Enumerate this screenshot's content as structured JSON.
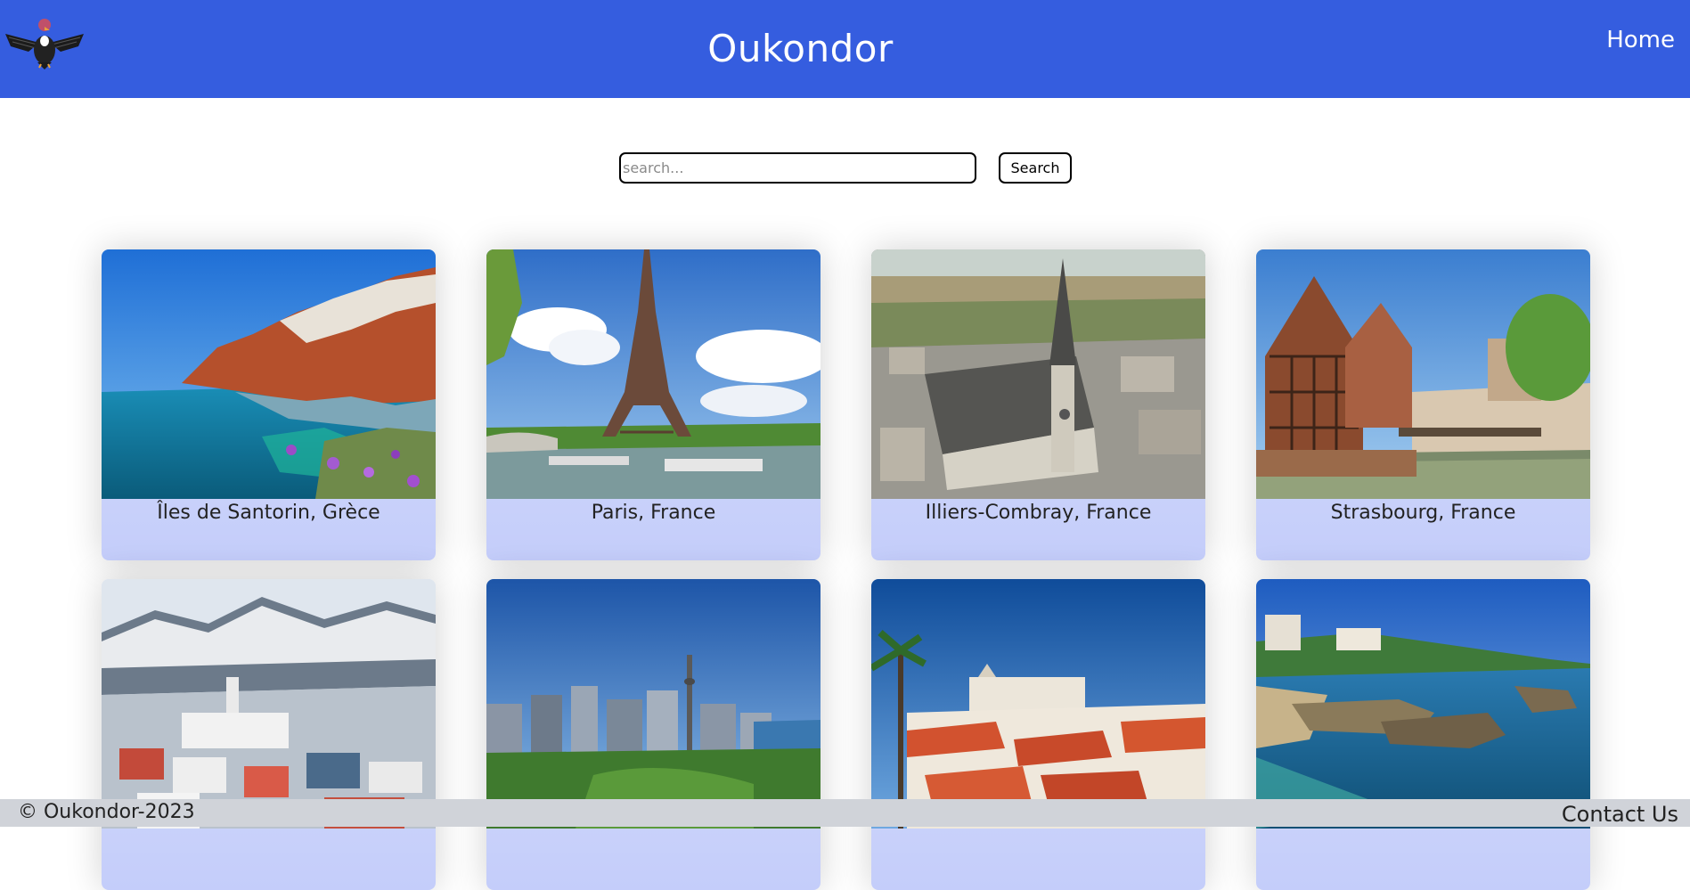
{
  "header": {
    "logo_icon": "condor-bird-logo-icon",
    "title": "Oukondor",
    "nav_home": "Home",
    "background_color": "#355ddf"
  },
  "search": {
    "placeholder": "search...",
    "value": "",
    "button_label": "Search"
  },
  "destinations": [
    {
      "label": "Îles de Santorin, Grèce",
      "image": "santorini-coast-photo"
    },
    {
      "label": "Paris, France",
      "image": "eiffel-tower-photo"
    },
    {
      "label": "Illiers-Combray, France",
      "image": "illiers-combray-church-photo"
    },
    {
      "label": "Strasbourg, France",
      "image": "strasbourg-timber-houses-photo"
    },
    {
      "label": "",
      "image": "snowy-mountain-town-photo"
    },
    {
      "label": "",
      "image": "city-skyline-tower-photo"
    },
    {
      "label": "",
      "image": "red-roof-old-town-photo"
    },
    {
      "label": "",
      "image": "rocky-coast-bay-photo"
    }
  ],
  "footer": {
    "copyright": "© Oukondor-2023",
    "contact": "Contact Us"
  }
}
